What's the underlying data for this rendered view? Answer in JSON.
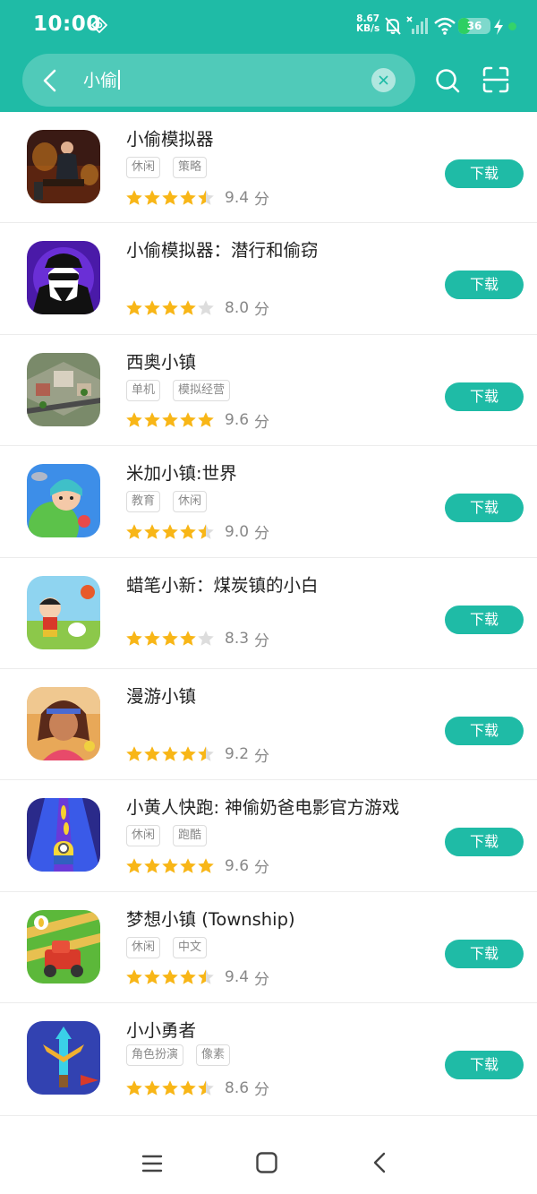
{
  "status": {
    "time": "10:00",
    "net_speed_value": "8.67",
    "net_speed_unit": "KB/s",
    "battery": "36",
    "battery_level": 0.36
  },
  "search": {
    "query": "小偷"
  },
  "download_label": "下载",
  "score_unit": "分",
  "apps": [
    {
      "name": "小偷模拟器",
      "tags": [
        "休闲",
        "策略"
      ],
      "stars": 4.5,
      "score": "9.4"
    },
    {
      "name": "小偷模拟器：潜行和偷窃",
      "tags": [],
      "stars": 4,
      "score": "8.0"
    },
    {
      "name": "西奥小镇",
      "tags": [
        "单机",
        "模拟经营"
      ],
      "stars": 5,
      "score": "9.6"
    },
    {
      "name": "米加小镇:世界",
      "tags": [
        "教育",
        "休闲"
      ],
      "stars": 4.5,
      "score": "9.0"
    },
    {
      "name": "蜡笔小新：煤炭镇的小白",
      "tags": [],
      "stars": 4,
      "score": "8.3"
    },
    {
      "name": "漫游小镇",
      "tags": [],
      "stars": 4.5,
      "score": "9.2"
    },
    {
      "name": "小黄人快跑: 神偷奶爸电影官方游戏",
      "tags": [
        "休闲",
        "跑酷"
      ],
      "stars": 5,
      "score": "9.6"
    },
    {
      "name": "梦想小镇 (Township)",
      "tags": [
        "休闲",
        "中文"
      ],
      "stars": 4.5,
      "score": "9.4"
    },
    {
      "name": "小小勇者",
      "tags": [
        "角色扮演",
        "像素"
      ],
      "stars": 4.5,
      "score": "8.6"
    }
  ],
  "icons": {
    "vpn": "vpn-key-icon",
    "mute": "bell-off-icon",
    "signal": "signal-off-icon",
    "wifi": "wifi-icon",
    "bolt": "charging-bolt-icon",
    "back": "back-arrow-icon",
    "clear": "clear-icon",
    "search": "search-icon",
    "scan": "scan-icon",
    "nav_menu": "menu-icon",
    "nav_home": "home-icon",
    "nav_back": "back-icon"
  },
  "colors": {
    "accent": "#1fbba6",
    "star": "#f8b617",
    "star_empty": "#dddddd"
  }
}
